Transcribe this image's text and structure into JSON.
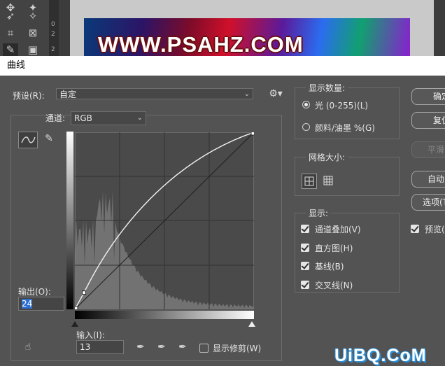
{
  "tools": [
    "move-icon",
    "lasso-icon",
    "magic-wand-icon",
    "crop-icon",
    "frame-icon",
    "eyedropper-icon",
    "brush-icon"
  ],
  "ruler_marks": [
    "0",
    "2",
    "2"
  ],
  "photo_text": "WWW.PSAHZ.COM",
  "dialog": {
    "title": "曲线",
    "preset_label": "预设(R):",
    "preset_value": "自定",
    "channel_label": "通道:",
    "channel_value": "RGB",
    "output_label": "输出(O):",
    "output_value": "24",
    "input_label": "输入(I):",
    "input_value": "13",
    "show_clipping": "显示修剪(W)",
    "display_amount": {
      "title": "显示数量:",
      "options": [
        "光 (0-255)(L)",
        "颜料/油墨 %(G)"
      ],
      "selected": 0
    },
    "grid_size": {
      "title": "网格大小:"
    },
    "show": {
      "title": "显示:",
      "items": [
        "通道叠加(V)",
        "直方图(H)",
        "基线(B)",
        "交叉线(N)"
      ]
    },
    "buttons": {
      "ok": "确定",
      "cancel": "复位",
      "smooth": "平滑",
      "auto": "自动",
      "options": "选项(T)..."
    },
    "preview_label": "预览(P)"
  },
  "curve": {
    "points": [
      [
        0,
        0
      ],
      [
        13,
        24
      ],
      [
        255,
        255
      ]
    ],
    "range": [
      0,
      255
    ]
  },
  "watermark": "UiBQ.CoM"
}
